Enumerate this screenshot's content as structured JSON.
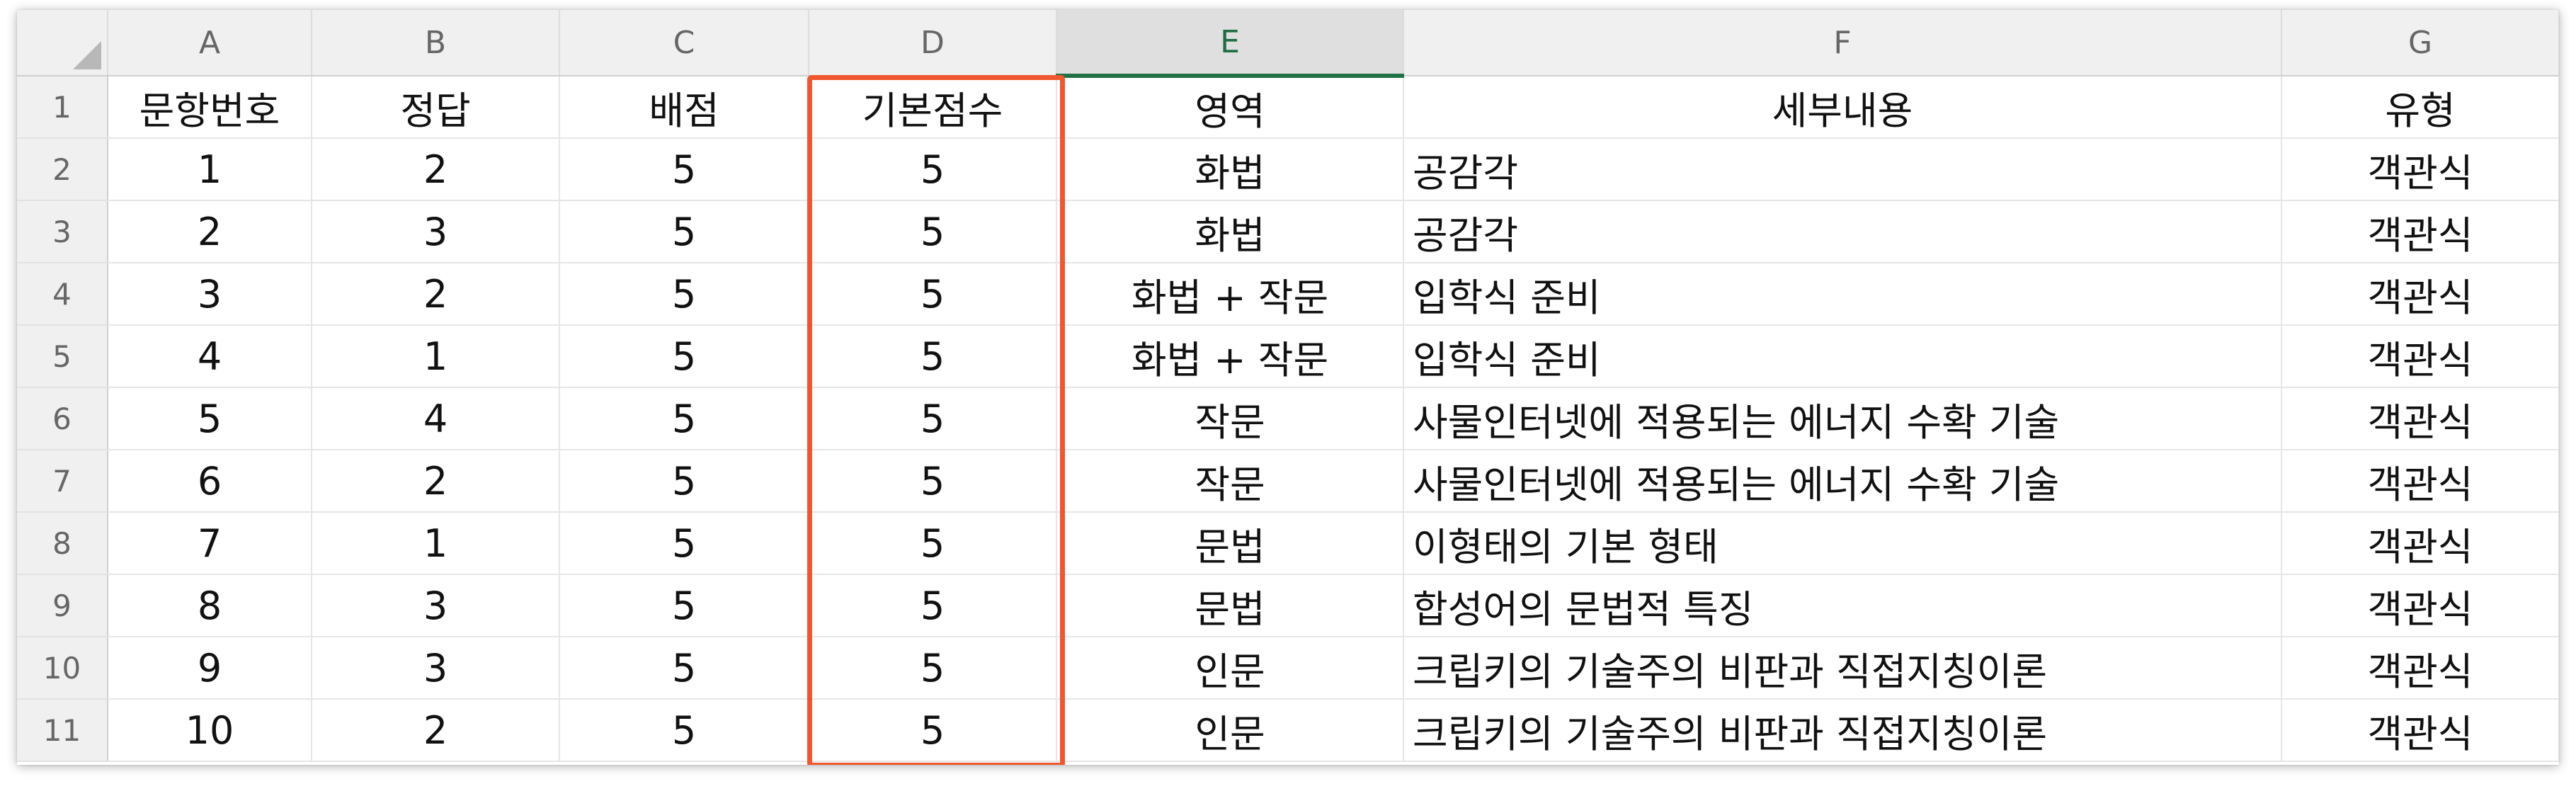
{
  "sheet": {
    "columns": [
      "A",
      "B",
      "C",
      "D",
      "E",
      "F",
      "G"
    ],
    "selected_column": "D",
    "headers": [
      "문항번호",
      "정답",
      "배점",
      "기본점수",
      "영역",
      "세부내용",
      "유형"
    ],
    "rows": [
      {
        "row": "2",
        "cells": [
          "1",
          "2",
          "5",
          "5",
          "화법",
          "공감각",
          "객관식"
        ]
      },
      {
        "row": "3",
        "cells": [
          "2",
          "3",
          "5",
          "5",
          "화법",
          "공감각",
          "객관식"
        ]
      },
      {
        "row": "4",
        "cells": [
          "3",
          "2",
          "5",
          "5",
          "화법 + 작문",
          "입학식 준비",
          "객관식"
        ]
      },
      {
        "row": "5",
        "cells": [
          "4",
          "1",
          "5",
          "5",
          "화법 + 작문",
          "입학식 준비",
          "객관식"
        ]
      },
      {
        "row": "6",
        "cells": [
          "5",
          "4",
          "5",
          "5",
          "작문",
          "사물인터넷에 적용되는 에너지 수확 기술",
          "객관식"
        ]
      },
      {
        "row": "7",
        "cells": [
          "6",
          "2",
          "5",
          "5",
          "작문",
          "사물인터넷에 적용되는 에너지 수확 기술",
          "객관식"
        ]
      },
      {
        "row": "8",
        "cells": [
          "7",
          "1",
          "5",
          "5",
          "문법",
          "이형태의 기본 형태",
          "객관식"
        ]
      },
      {
        "row": "9",
        "cells": [
          "8",
          "3",
          "5",
          "5",
          "문법",
          "합성어의 문법적 특징",
          "객관식"
        ]
      },
      {
        "row": "10",
        "cells": [
          "9",
          "3",
          "5",
          "5",
          "인문",
          "크립키의 기술주의 비판과 직접지칭이론",
          "객관식"
        ]
      },
      {
        "row": "11",
        "cells": [
          "10",
          "2",
          "5",
          "5",
          "인문",
          "크립키의 기술주의 비판과 직접지칭이론",
          "객관식"
        ]
      }
    ],
    "header_row_label": "1"
  },
  "colors": {
    "highlight_border": "#f0572e",
    "selected_col_accent": "#217346",
    "header_bg": "#f0f0f0"
  }
}
